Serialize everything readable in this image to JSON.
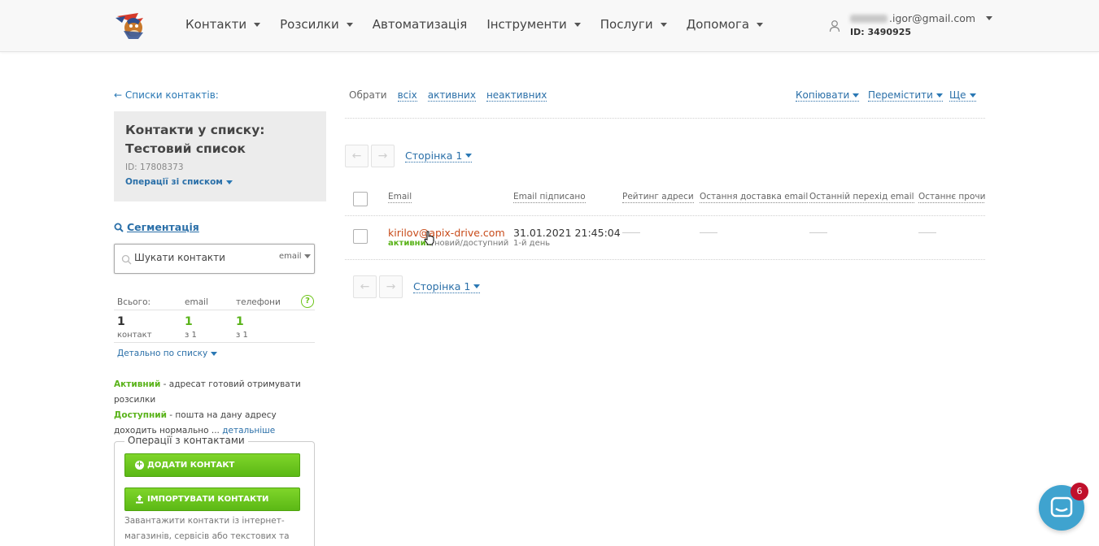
{
  "header": {
    "nav": [
      {
        "label": "Контакти",
        "caret": true
      },
      {
        "label": "Розсилки",
        "caret": true
      },
      {
        "label": "Автоматизація",
        "caret": false
      },
      {
        "label": "Інструменти",
        "caret": true
      },
      {
        "label": "Послуги",
        "caret": true
      },
      {
        "label": "Допомога",
        "caret": true
      }
    ],
    "user_email": ".igor@gmail.com",
    "user_id": "ID: 3490925"
  },
  "sidebar": {
    "back_link": "← Списки контактів:",
    "list_title": "Контакти у списку: Тестовий список",
    "list_id": "ID: 17808373",
    "list_ops": "Операції зі списком",
    "segmentation": "Сегментація",
    "search_placeholder": "Шукати контакти",
    "search_type": "email",
    "stats": {
      "headers": [
        "Всього:",
        "email",
        "телефони"
      ],
      "total": "1",
      "total_sub": "контакт",
      "email": "1",
      "email_sub": "з 1",
      "phone": "1",
      "phone_sub": "з 1",
      "detail_link": "Детально по списку"
    },
    "legend": {
      "active_label": "Активний",
      "active_text": " - адресат готовий отримувати розсилки",
      "available_label": "Доступний",
      "available_text": " - пошта на дану адресу доходить нормально ... ",
      "more": "детальніше"
    },
    "ops": {
      "title": "Операції з контактами",
      "add_btn": "ДОДАТИ КОНТАКТ",
      "import_btn": "ІМПОРТУВАТИ КОНТАКТИ",
      "note": "Завантажити контакти із інтернет-магазинів, сервісів або текстових та Excel-файлів"
    }
  },
  "main": {
    "select_label": "Обрати",
    "select_all": "всіх",
    "select_active": "активних",
    "select_inactive": "неактивних",
    "copy": "Копіювати",
    "move": "Перемістити",
    "more": "Ще",
    "page": "Сторінка 1",
    "columns": [
      "Email",
      "Email підписано",
      "Рейтинг адреси",
      "Остання доставка email",
      "Останній перехід email",
      "Останнє прочита"
    ],
    "rows": [
      {
        "email": "kirilov@apix-drive.com",
        "status_active": "активний",
        "status_rest": "/новий/доступний",
        "date": "31.01.2021 21:45:04",
        "day": "1-й день"
      }
    ]
  },
  "chat": {
    "badge": "6"
  },
  "colors": {
    "link": "#2a6fa8",
    "green": "#5ab31a",
    "email": "#c84b1a",
    "chat": "#3fa3cf"
  }
}
